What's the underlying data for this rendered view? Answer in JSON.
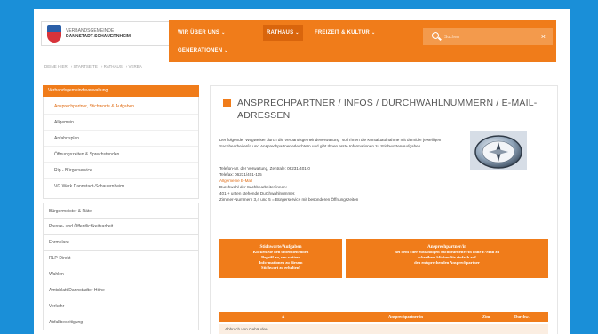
{
  "header": {
    "logo_line1": "VERBANDSGEMEINDE",
    "logo_line2": "DANNSTADT-SCHAUERNHEIM"
  },
  "nav": {
    "items": [
      {
        "label": "WIR ÜBER UNS"
      },
      {
        "label": "RATHAUS"
      },
      {
        "label": "FREIZEIT & KULTUR"
      },
      {
        "label": "GENERATIONEN"
      }
    ],
    "search_placeholder": "Suchen"
  },
  "breadcrumb": [
    "DEINE HIER",
    "STARTSEITE",
    "RATHAUS",
    "VERBA"
  ],
  "sidebar": {
    "header": "Verbandsgemeindeverwaltung",
    "sub_items": [
      {
        "label": "Ansprechpartner, Stichworte & Aufgaben"
      },
      {
        "label": "Allgemein"
      },
      {
        "label": "Anfahrtsplan"
      },
      {
        "label": "Öffnungszeiten & Sprechstunden"
      },
      {
        "label": "Rip - Bürgerservice"
      },
      {
        "label": "VG Werk Dannstadt-Schauernheim"
      }
    ],
    "main_items": [
      {
        "label": "Bürgermeister & Räte"
      },
      {
        "label": "Presse- und Öffentlichkeitsarbeit"
      },
      {
        "label": "Formulare"
      },
      {
        "label": "RLP-Direkt"
      },
      {
        "label": "Wahlen"
      },
      {
        "label": "Amtsblatt Dannstadter Höhe"
      },
      {
        "label": "Verkehr"
      },
      {
        "label": "Abfallbeseitigung"
      }
    ]
  },
  "content": {
    "title": "ANSPRECHPARTNER / INFOS / DURCHWAHLNUMMERN / E-MAIL-ADRESSEN",
    "paragraph1": "Der folgende \"Wegweiser durch die Verbandsgemeindeverwaltung\" soll Ihnen die Kontaktaufnahme mit dem/der jeweiligen Sachbearbeiter/in und Ansprechpartner erleichtern und gibt Ihnen erste Informationen zu Stichworten/Aufgaben.",
    "p2_lines": [
      "Telefon-Nr. der Verwaltung, Zentrale: 06231/401-0",
      "Telefax: 06231/401-115",
      "Allgemeine E-Mail",
      "Durchwahl der Sachbearbeiter/innen:",
      "401 + unten stehende Durchwahlnummer.",
      "Zimmer-Nummern 3,4 und 5 = Bürgerservice mit besonderen Öffnungszeiten"
    ],
    "block_left_lines": [
      "Stichworte/Aufgaben",
      "Klicken Sie den untenstehenden",
      "Begriff an, um weitere",
      "Informationen zu diesem",
      "Stichwort zu erhalten!"
    ],
    "block_right_lines": [
      "Ansprechpartner/in",
      "Bei dem / der zuständigen Sachbearbeiter/in ohne E-Mail zu",
      "schreiben, klicken Sie einfach auf",
      "den entsprechenden Ansprechpartner"
    ],
    "table_headers": [
      "A",
      "Ansprechpartner/in",
      "Zim.",
      "Durchw."
    ],
    "table_row_first": "Abbruch von Gebäuden"
  },
  "colors": {
    "accent": "#f07c1a",
    "background": "#1a8fd8"
  }
}
